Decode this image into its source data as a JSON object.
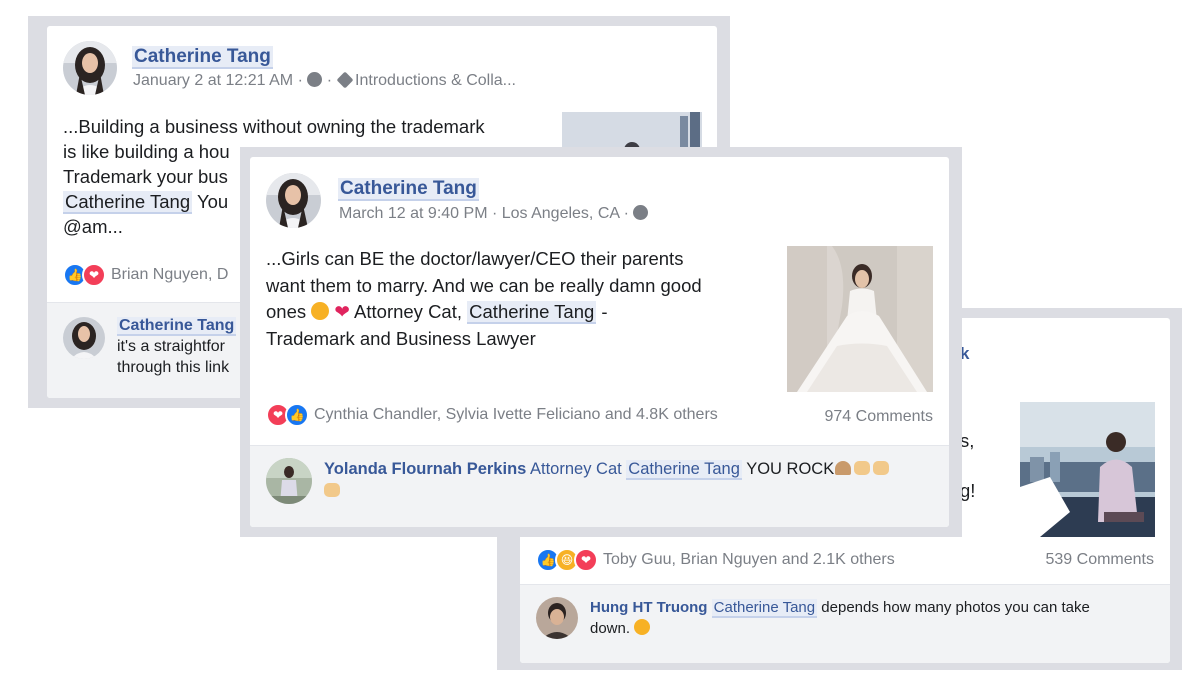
{
  "post1": {
    "author": "Catherine Tang",
    "date": "January 2 at 12:21 AM",
    "sep": "·",
    "tag": "Introductions & Colla...",
    "line1": "...Building a business without owning the trademark",
    "line2": "is like building a hou",
    "line3": "Trademark your bus",
    "line4_mention": "Catherine Tang",
    "line4_rest": " You",
    "line5": "@am...",
    "reactors": "Brian Nguyen, D",
    "comment_author": "Catherine Tang",
    "comment_line1": "it's a straightfor",
    "comment_line2": "through this link"
  },
  "post2": {
    "author": "Catherine Tang",
    "date": "March 12 at 9:40 PM",
    "sep": "·",
    "location": "Los Angeles, CA",
    "line1": "...Girls can BE the doctor/lawyer/CEO their parents",
    "line2": "want them to marry. And we can be really damn good",
    "line3_pre": "ones",
    "line3_mid": " Attorney Cat, ",
    "line3_mention": "Catherine Tang",
    "line3_post": " -",
    "line4": "Trademark and Business Lawyer",
    "reactors": "Cynthia Chandler, Sylvia Ivette Feliciano and 4.8K others",
    "comments": "974 Comments",
    "comment_author": "Yolanda Flournah Perkins",
    "comment_pre": " Attorney Cat ",
    "comment_mention": "Catherine Tang",
    "comment_post": " YOU ROCK"
  },
  "post3": {
    "snippet_a": "s,",
    "snippet_b": "g!",
    "reactors": "Toby Guu, Brian Nguyen and 2.1K others",
    "comments": "539 Comments",
    "comment_author": "Hung HT Truong",
    "comment_mention": "Catherine Tang",
    "comment_rest": " depends how many photos you can take",
    "comment_line2": "down."
  },
  "colors": {
    "link": "#385898",
    "like": "#1877f2",
    "love": "#f33e58",
    "haha": "#f7b125",
    "meta": "#7b7f86"
  },
  "icons": [
    "group-icon",
    "tag-icon",
    "like-icon",
    "love-icon",
    "haha-icon",
    "wink-emoji",
    "heart-emoji",
    "praying-hands-emoji",
    "raised-hands-emoji",
    "laughing-emoji"
  ]
}
